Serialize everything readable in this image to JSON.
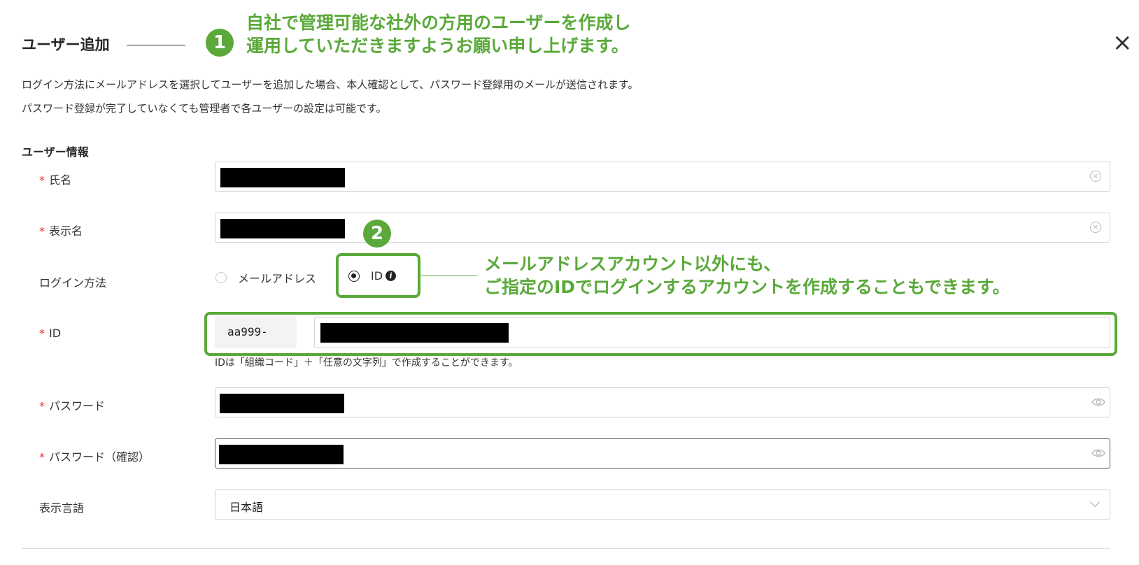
{
  "dialog": {
    "title": "ユーザー追加",
    "close_label": "×",
    "description": [
      "ログイン方法にメールアドレスを選択してユーザーを追加した場合、本人確認として、パスワード登録用のメールが送信されます。",
      "パスワード登録が完了していなくても管理者で各ユーザーの設定は可能です。"
    ]
  },
  "user_info": {
    "section_title": "ユーザー情報",
    "required_mark": "*",
    "full_name": {
      "label": "氏名",
      "value": ""
    },
    "display_name": {
      "label": "表示名",
      "value": ""
    },
    "login_method": {
      "label": "ログイン方法",
      "options": [
        "メールアドレス",
        "ID"
      ],
      "selected": "ID"
    },
    "id_field": {
      "label": "ID",
      "prefix": "aa999-",
      "value": "",
      "hint": "IDは「組織コード」＋「任意の文字列」で作成することができます。"
    },
    "password": {
      "label": "パスワード",
      "value": ""
    },
    "password_confirm": {
      "label": "パスワード（確認）",
      "value": ""
    },
    "language": {
      "label": "表示言語",
      "value": "日本語"
    }
  },
  "annotations": {
    "callout_1": {
      "number": "❶",
      "lines": [
        "自社で管理可能な社外の方用のユーザーを作成し",
        "運用していただきますようお願い申し上げます。"
      ]
    },
    "callout_2": {
      "number": "❷",
      "lines": [
        "メールアドレスアカウント以外にも、",
        "ご指定のIDでログインするアカウントを作成することもできます。"
      ]
    }
  },
  "colors": {
    "annotation_green": "#5aa93a",
    "required_red": "#e53935",
    "redaction": "#000000"
  },
  "icons": {
    "clear": "clear-circle-icon",
    "eye": "eye-icon",
    "info": "info-icon",
    "close": "close-icon",
    "chevron": "chevron-down-icon"
  }
}
